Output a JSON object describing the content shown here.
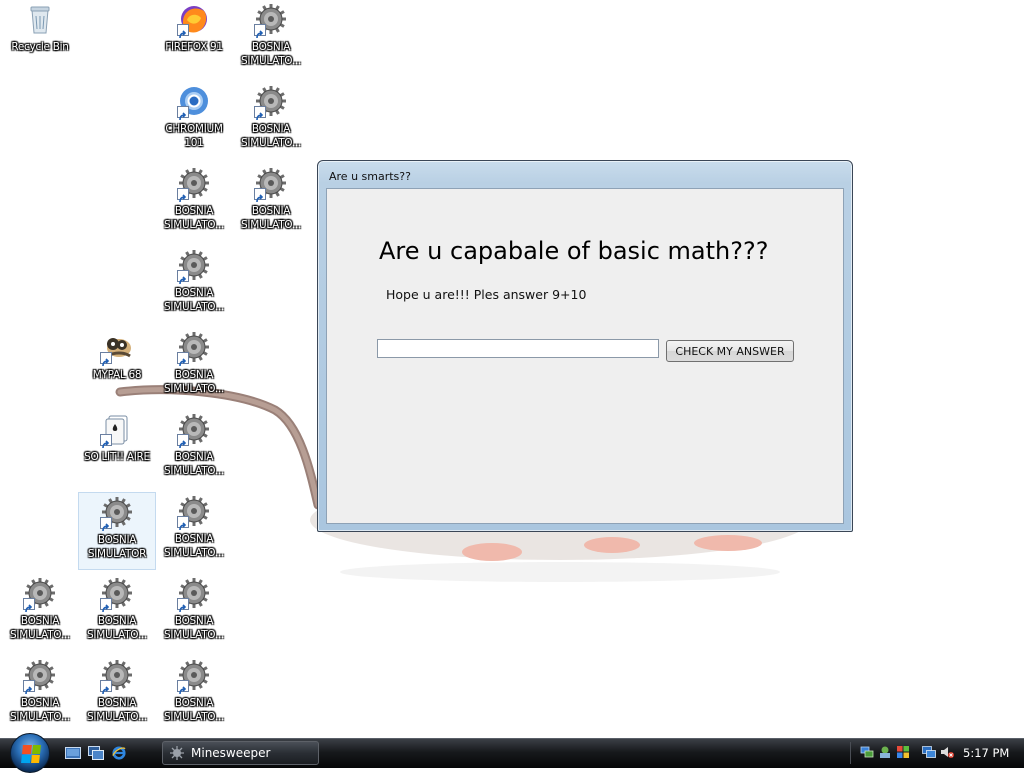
{
  "desktop": {
    "icons": [
      {
        "label": "Recycle Bin",
        "icon": "recycle-bin-icon"
      },
      {
        "label": "FIREFOX 91",
        "icon": "firefox-icon"
      },
      {
        "label": "BOSNIA SIMULATO...",
        "icon": "bosnia-gear-icon"
      },
      {
        "label": "CHROMIUM 101",
        "icon": "chromium-icon"
      },
      {
        "label": "BOSNIA SIMULATO...",
        "icon": "bosnia-gear-icon"
      },
      {
        "label": "BOSNIA SIMULATO...",
        "icon": "bosnia-gear-icon"
      },
      {
        "label": "BOSNIA SIMULATO...",
        "icon": "bosnia-gear-icon"
      },
      {
        "label": "BOSNIA SIMULATO...",
        "icon": "bosnia-gear-icon"
      },
      {
        "label": "MYPAL 68",
        "icon": "mypal-icon"
      },
      {
        "label": "BOSNIA SIMULATO...",
        "icon": "bosnia-gear-icon"
      },
      {
        "label": "SO LIT!! AIRE",
        "icon": "solitaire-icon"
      },
      {
        "label": "BOSNIA SIMULATO...",
        "icon": "bosnia-gear-icon"
      },
      {
        "label": "BOSNIA SIMULATOR",
        "icon": "bosnia-gear-icon"
      },
      {
        "label": "BOSNIA SIMULATO...",
        "icon": "bosnia-gear-icon"
      },
      {
        "label": "BOSNIA SIMULATO...",
        "icon": "bosnia-gear-icon"
      },
      {
        "label": "BOSNIA SIMULATO...",
        "icon": "bosnia-gear-icon"
      },
      {
        "label": "BOSNIA SIMULATO...",
        "icon": "bosnia-gear-icon"
      },
      {
        "label": "BOSNIA SIMULATO...",
        "icon": "bosnia-gear-icon"
      },
      {
        "label": "BOSNIA SIMULATO...",
        "icon": "bosnia-gear-icon"
      },
      {
        "label": "BOSNIA SIMULATO...",
        "icon": "bosnia-gear-icon"
      }
    ]
  },
  "dialog": {
    "title": "Are u smarts??",
    "heading": "Are u capabale of basic math???",
    "subtext": "Hope u are!!! Ples answer 9+10",
    "answer_value": "",
    "answer_placeholder": "",
    "check_button_label": "CHECK MY ANSWER"
  },
  "taskbar": {
    "start_icon": "windows-start-orb-icon",
    "quick_launch": [
      "show-desktop-icon",
      "switch-windows-icon",
      "internet-explorer-icon"
    ],
    "task_button_label": "Minesweeper",
    "task_button_icon": "minesweeper-icon",
    "tray_icons": [
      "network-icon",
      "safely-remove-icon",
      "action-center-icon",
      "network-status-icon",
      "volume-muted-icon"
    ],
    "clock": "5:17 PM"
  },
  "colors": {
    "dialog_frame": "#b9d0e4",
    "dialog_client": "#efefef",
    "taskbar": "#17191c",
    "label_text": "#ffffff"
  }
}
